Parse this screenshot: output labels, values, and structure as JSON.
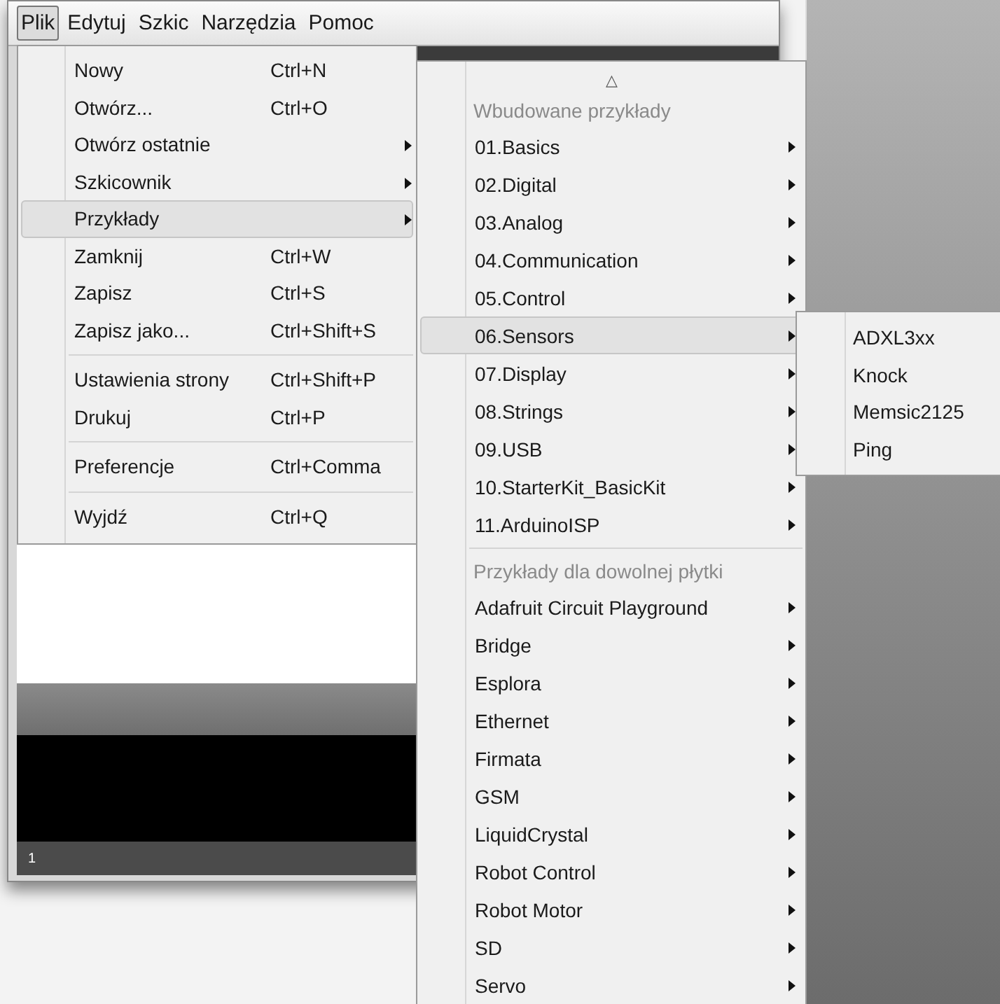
{
  "menubar": [
    {
      "label": "Plik",
      "selected": true
    },
    {
      "label": "Edytuj",
      "selected": false
    },
    {
      "label": "Szkic",
      "selected": false
    },
    {
      "label": "Narzędzia",
      "selected": false
    },
    {
      "label": "Pomoc",
      "selected": false
    }
  ],
  "file_menu": [
    {
      "kind": "item",
      "label": "Nowy",
      "shortcut": "Ctrl+N",
      "submenu": false,
      "selected": false
    },
    {
      "kind": "item",
      "label": "Otwórz...",
      "shortcut": "Ctrl+O",
      "submenu": false,
      "selected": false
    },
    {
      "kind": "item",
      "label": "Otwórz ostatnie",
      "submenu": true,
      "selected": false
    },
    {
      "kind": "item",
      "label": "Szkicownik",
      "submenu": true,
      "selected": false
    },
    {
      "kind": "item",
      "label": "Przykłady",
      "submenu": true,
      "selected": true
    },
    {
      "kind": "item",
      "label": "Zamknij",
      "shortcut": "Ctrl+W",
      "submenu": false,
      "selected": false
    },
    {
      "kind": "item",
      "label": "Zapisz",
      "shortcut": "Ctrl+S",
      "submenu": false,
      "selected": false
    },
    {
      "kind": "item",
      "label": "Zapisz jako...",
      "shortcut": "Ctrl+Shift+S",
      "submenu": false,
      "selected": false
    },
    {
      "kind": "separator"
    },
    {
      "kind": "item",
      "label": "Ustawienia strony",
      "shortcut": "Ctrl+Shift+P",
      "submenu": false,
      "selected": false
    },
    {
      "kind": "item",
      "label": "Drukuj",
      "shortcut": "Ctrl+P",
      "submenu": false,
      "selected": false
    },
    {
      "kind": "separator"
    },
    {
      "kind": "item",
      "label": "Preferencje",
      "shortcut": "Ctrl+Comma",
      "submenu": false,
      "selected": false
    },
    {
      "kind": "separator"
    },
    {
      "kind": "item",
      "label": "Wyjdź",
      "shortcut": "Ctrl+Q",
      "submenu": false,
      "selected": false
    }
  ],
  "examples_menu": [
    {
      "kind": "scroll",
      "label": "△"
    },
    {
      "kind": "header",
      "label": "Wbudowane przykłady"
    },
    {
      "kind": "item",
      "label": "01.Basics",
      "selected": false
    },
    {
      "kind": "item",
      "label": "02.Digital",
      "selected": false
    },
    {
      "kind": "item",
      "label": "03.Analog",
      "selected": false
    },
    {
      "kind": "item",
      "label": "04.Communication",
      "selected": false
    },
    {
      "kind": "item",
      "label": "05.Control",
      "selected": false
    },
    {
      "kind": "item",
      "label": "06.Sensors",
      "selected": true
    },
    {
      "kind": "item",
      "label": "07.Display",
      "selected": false
    },
    {
      "kind": "item",
      "label": "08.Strings",
      "selected": false
    },
    {
      "kind": "item",
      "label": "09.USB",
      "selected": false
    },
    {
      "kind": "item",
      "label": "10.StarterKit_BasicKit",
      "selected": false
    },
    {
      "kind": "item",
      "label": "11.ArduinoISP",
      "selected": false
    },
    {
      "kind": "separator"
    },
    {
      "kind": "header",
      "label": "Przykłady dla dowolnej płytki"
    },
    {
      "kind": "item",
      "label": "Adafruit Circuit Playground",
      "selected": false
    },
    {
      "kind": "item",
      "label": "Bridge",
      "selected": false
    },
    {
      "kind": "item",
      "label": "Esplora",
      "selected": false
    },
    {
      "kind": "item",
      "label": "Ethernet",
      "selected": false
    },
    {
      "kind": "item",
      "label": "Firmata",
      "selected": false
    },
    {
      "kind": "item",
      "label": "GSM",
      "selected": false
    },
    {
      "kind": "item",
      "label": "LiquidCrystal",
      "selected": false
    },
    {
      "kind": "item",
      "label": "Robot Control",
      "selected": false
    },
    {
      "kind": "item",
      "label": "Robot Motor",
      "selected": false
    },
    {
      "kind": "item",
      "label": "SD",
      "selected": false
    },
    {
      "kind": "item",
      "label": "Servo",
      "selected": false
    }
  ],
  "sensors_menu": [
    "ADXL3xx",
    "Knock",
    "Memsic2125",
    "Ping"
  ],
  "status_bar": {
    "line": "1"
  }
}
